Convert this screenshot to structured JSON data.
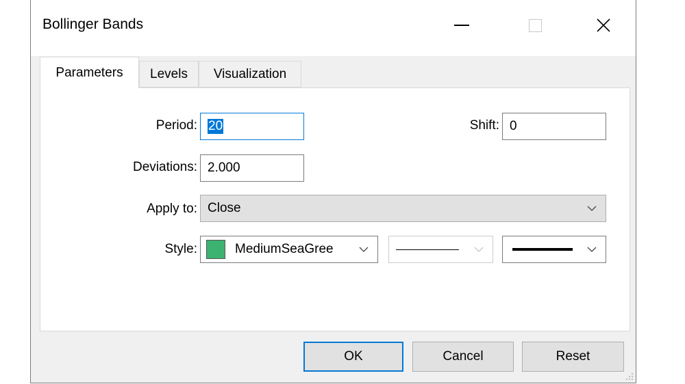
{
  "window": {
    "title": "Bollinger Bands",
    "controls": {
      "minimize": "minimize-icon",
      "maximize": "maximize-icon",
      "close": "close-icon"
    }
  },
  "tabs": [
    {
      "label": "Parameters",
      "active": true
    },
    {
      "label": "Levels",
      "active": false
    },
    {
      "label": "Visualization",
      "active": false
    }
  ],
  "form": {
    "period_label": "Period:",
    "period_value": "20",
    "shift_label": "Shift:",
    "shift_value": "0",
    "deviations_label": "Deviations:",
    "deviations_value": "2.000",
    "apply_label": "Apply to:",
    "apply_value": "Close",
    "style_label": "Style:",
    "color_name": "MediumSeaGree",
    "color_hex": "#3cb371"
  },
  "buttons": {
    "ok": "OK",
    "cancel": "Cancel",
    "reset": "Reset"
  },
  "colors": {
    "accent": "#0078d7",
    "window_bg": "#f0f0f0",
    "button_bg": "#e1e1e1"
  }
}
